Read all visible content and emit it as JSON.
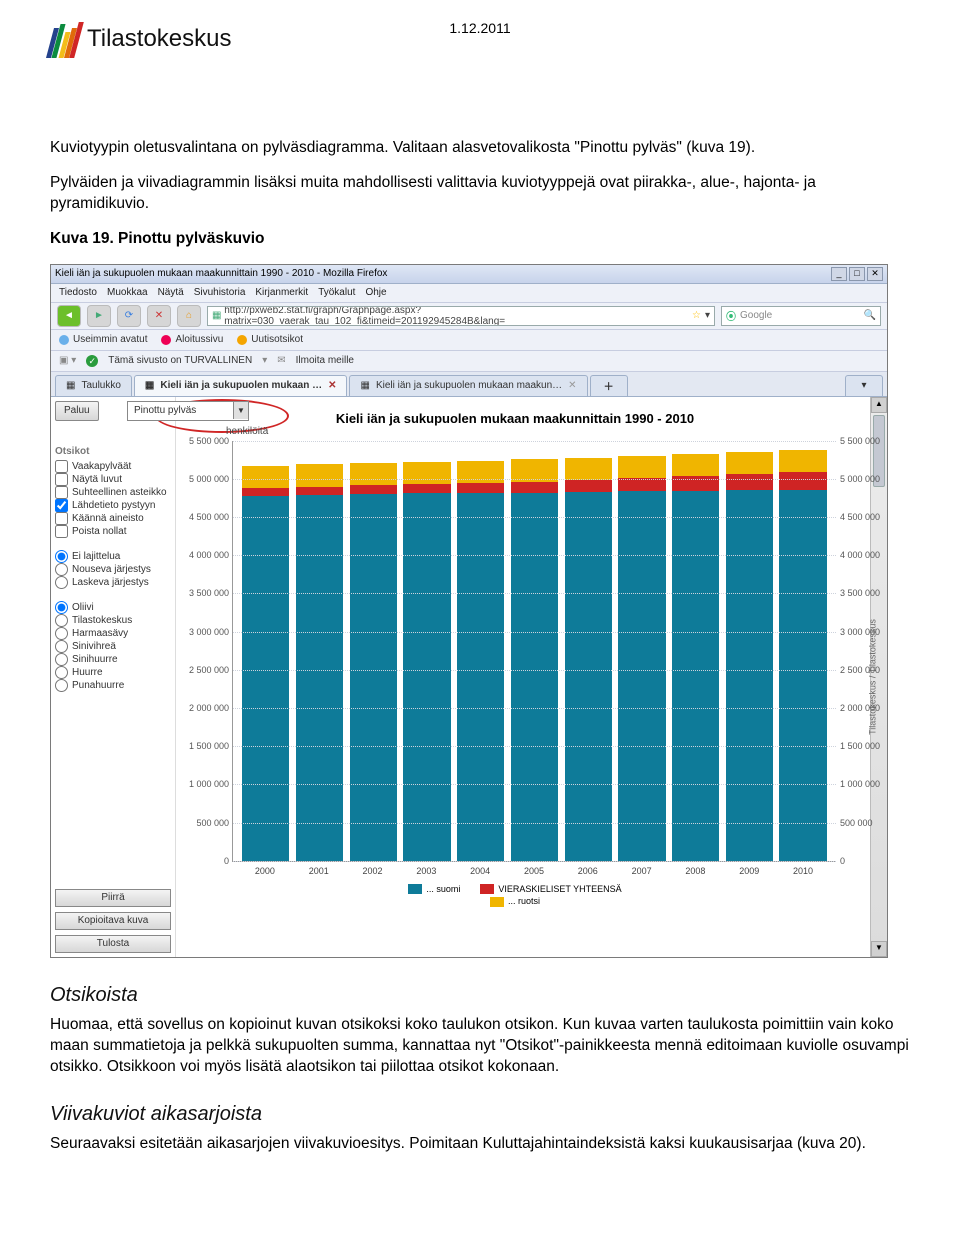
{
  "header": {
    "brand": "Tilastokeskus",
    "date": "1.12.2011"
  },
  "intro": {
    "p1": "Kuviotyypin oletusvalintana on pylväsdiagramma. Valitaan alasvetovalikosta \"Pinottu pylväs\" (kuva 19).",
    "p2": "Pylväiden ja viivadiagrammin lisäksi muita mahdollisesti valittavia kuviotyyppejä ovat piirakka-, alue-, hajonta- ja pyramidikuvio.",
    "caption": "Kuva 19. Pinottu pylväskuvio"
  },
  "browser": {
    "title": "Kieli iän ja sukupuolen mukaan maakunnittain 1990 - 2010 - Mozilla Firefox",
    "menus": [
      "Tiedosto",
      "Muokkaa",
      "Näytä",
      "Sivuhistoria",
      "Kirjanmerkit",
      "Työkalut",
      "Ohje"
    ],
    "url": "http://pxweb2.stat.fi/graph/Graphpage.aspx?matrix=030_vaerak_tau_102_fi&timeid=201192945284B&lang=",
    "search_placeholder": "Google",
    "bookmarks": {
      "label": "Useimmin avatut",
      "home": "Aloitussivu",
      "news": "Uutisotsikot"
    },
    "safebar": {
      "ok": "✓",
      "text": "Tämä sivusto on TURVALLINEN",
      "report": "Ilmoita meille"
    },
    "tabs": [
      {
        "label": "Taulukko"
      },
      {
        "label": "Kieli iän ja sukupuolen mukaan …",
        "active": true
      },
      {
        "label": "Kieli iän ja sukupuolen mukaan maakun…"
      }
    ],
    "sidebar": {
      "back": "Paluu",
      "dropdown": "Pinottu pylväs",
      "section1": "Otsikot",
      "opts1": [
        {
          "type": "cb",
          "label": "Vaakapylväät",
          "checked": false
        },
        {
          "type": "cb",
          "label": "Näytä luvut",
          "checked": false
        },
        {
          "type": "cb",
          "label": "Suhteellinen asteikko",
          "checked": false
        },
        {
          "type": "cb",
          "label": "Lähdetieto pystyyn",
          "checked": true
        },
        {
          "type": "cb",
          "label": "Käännä aineisto",
          "checked": false
        },
        {
          "type": "cb",
          "label": "Poista nollat",
          "checked": false
        }
      ],
      "opts2": [
        {
          "type": "rb",
          "label": "Ei lajittelua",
          "checked": true
        },
        {
          "type": "rb",
          "label": "Nouseva järjestys",
          "checked": false
        },
        {
          "type": "rb",
          "label": "Laskeva järjestys",
          "checked": false
        }
      ],
      "opts3": [
        {
          "type": "rb",
          "label": "Oliivi",
          "checked": true
        },
        {
          "type": "rb",
          "label": "Tilastokeskus",
          "checked": false
        },
        {
          "type": "rb",
          "label": "Harmaasävy",
          "checked": false
        },
        {
          "type": "rb",
          "label": "Sinivihreä",
          "checked": false
        },
        {
          "type": "rb",
          "label": "Sinihuurre",
          "checked": false
        },
        {
          "type": "rb",
          "label": "Huurre",
          "checked": false
        },
        {
          "type": "rb",
          "label": "Punahuurre",
          "checked": false
        }
      ],
      "btns": [
        "Piirrä",
        "Kopioitava kuva",
        "Tulosta"
      ]
    }
  },
  "chart_data": {
    "type": "bar",
    "stacked": true,
    "title": "Kieli iän ja sukupuolen mukaan maakunnittain 1990 - 2010",
    "unit": "henkilöitä",
    "ylim": [
      0,
      5500000
    ],
    "yticks": [
      0,
      500000,
      1000000,
      1500000,
      2000000,
      2500000,
      3000000,
      3500000,
      4000000,
      4500000,
      5000000,
      5500000
    ],
    "categories": [
      "2000",
      "2001",
      "2002",
      "2003",
      "2004",
      "2005",
      "2006",
      "2007",
      "2008",
      "2009",
      "2010"
    ],
    "series": [
      {
        "name": "... suomi",
        "color": "#0E7B99",
        "values": [
          4780000,
          4790000,
          4800000,
          4810000,
          4820000,
          4820000,
          4830000,
          4840000,
          4840000,
          4850000,
          4860000
        ]
      },
      {
        "name": "VIERASKIELISET YHTEENSÄ",
        "color": "#CF2424",
        "values": [
          100000,
          110000,
          115000,
          120000,
          130000,
          145000,
          160000,
          175000,
          195000,
          210000,
          230000
        ]
      },
      {
        "name": "... ruotsi",
        "color": "#F0B500",
        "values": [
          291000,
          290000,
          290000,
          290000,
          290000,
          290000,
          290000,
          290000,
          290000,
          290000,
          290000
        ]
      }
    ],
    "source": "Tilastokeskus / Tilastokeskus",
    "legend_order": [
      "... suomi",
      "VIERASKIELISET YHTEENSÄ",
      "... ruotsi"
    ]
  },
  "after": {
    "h1": "Otsikoista",
    "p1": "Huomaa, että sovellus on kopioinut kuvan otsikoksi koko taulukon otsikon. Kun kuvaa varten taulukosta poimittiin vain koko maan summatietoja ja pelkkä sukupuolten summa, kannattaa nyt \"Otsikot\"-painikkeesta mennä editoimaan kuviolle osuvampi otsikko. Otsikkoon voi myös lisätä alaotsikon tai piilottaa otsikot kokonaan.",
    "h2": "Viivakuviot aikasarjoista",
    "p2": "Seuraavaksi esitetään aikasarjojen viivakuvioesitys. Poimitaan Kuluttajahintaindeksistä kaksi kuukausisarjaa (kuva 20)."
  }
}
